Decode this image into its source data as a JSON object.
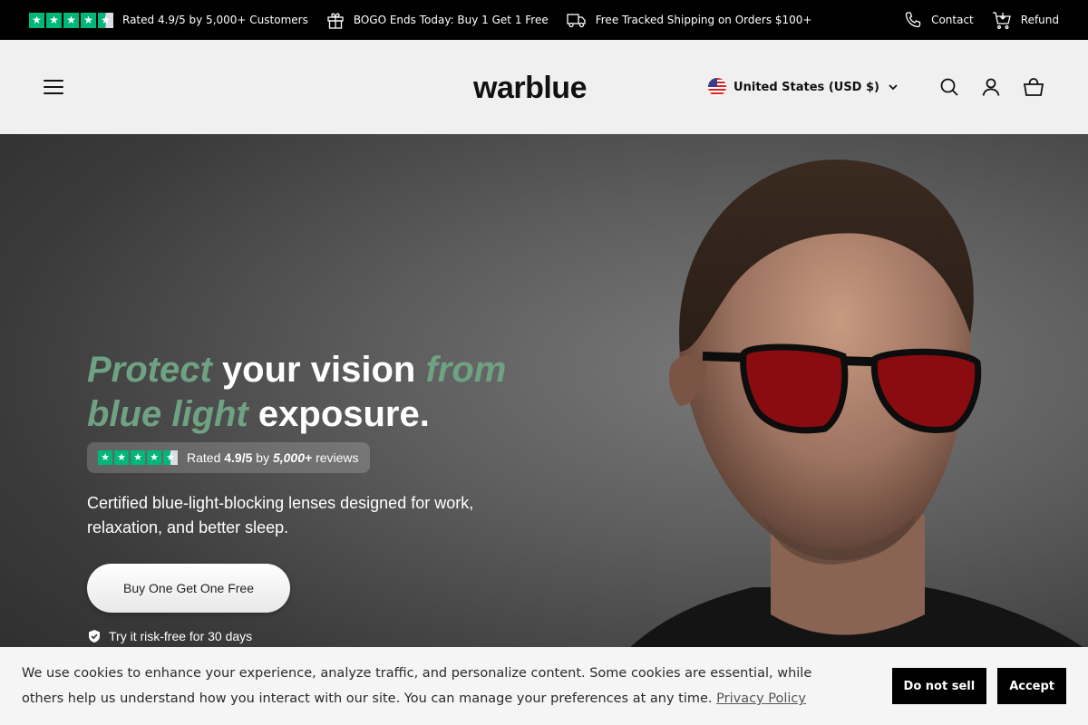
{
  "announcement": {
    "rating_text": "Rated 4.9/5 by 5,000+ Customers",
    "promo_text": "BOGO Ends Today: Buy 1 Get 1 Free",
    "shipping_text": "Free Tracked Shipping on Orders $100+",
    "contact_label": "Contact",
    "refund_label": "Refund",
    "trustpilot_stars": 4.5,
    "brand_green": "#00b67a"
  },
  "header": {
    "logo": "warblue",
    "country_selector": "United States (USD $)",
    "icons": [
      "menu-icon",
      "search-icon",
      "account-icon",
      "cart-icon"
    ]
  },
  "hero": {
    "headline": {
      "accent_1": "Protect",
      "plain_1": "your vision",
      "accent_2": "from",
      "accent_3": "blue light",
      "plain_2": "exposure."
    },
    "accent_color": "#6fa283",
    "rating": {
      "prefix": "Rated",
      "score": "4.9/5",
      "by": "by",
      "count": "5,000+",
      "suffix": "reviews",
      "stars": 4.5
    },
    "subtext": "Certified blue-light-blocking lenses designed for work, relaxation, and better sleep.",
    "cta_label": "Buy One Get One Free",
    "guarantee_text": "Try it risk-free for 30 days"
  },
  "cookie_banner": {
    "text": "We use cookies to enhance your experience, analyze traffic, and personalize content. Some cookies are essential, while others help us understand how you interact with our site. You can manage your preferences at any time.",
    "link_label": "Privacy Policy",
    "do_not_sell_label": "Do not sell",
    "accept_label": "Accept"
  }
}
